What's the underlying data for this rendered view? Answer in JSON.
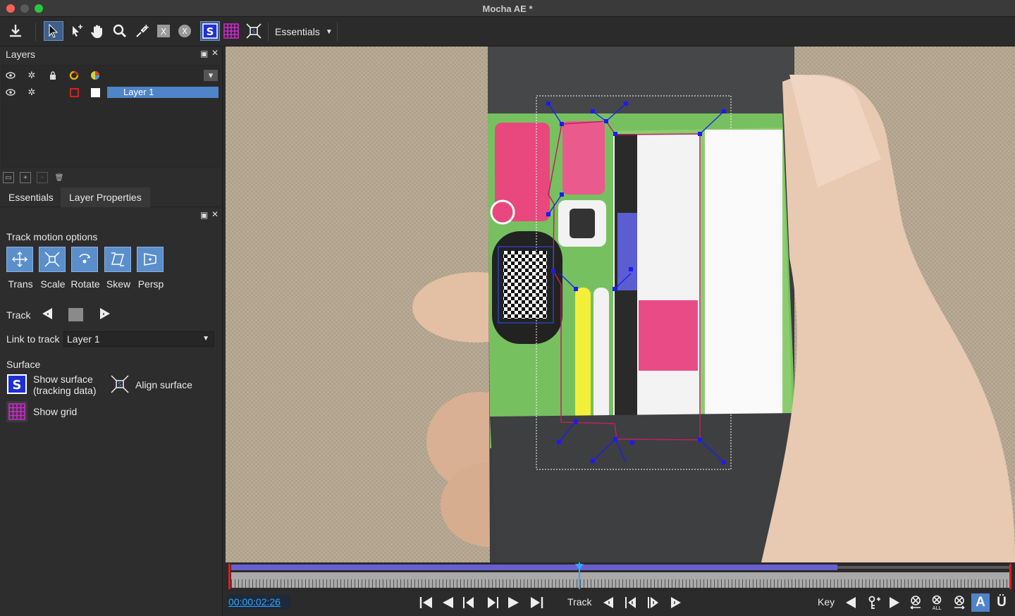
{
  "window": {
    "title": "Mocha AE *"
  },
  "toolbar": {
    "workspace_label": "Essentials",
    "buttons": [
      "export-icon",
      "pointer-icon",
      "add-point-icon",
      "hand-icon",
      "zoom-icon",
      "pen-icon",
      "x-spline-icon",
      "bezier-icon",
      "surface-icon",
      "grid-icon",
      "align-icon"
    ]
  },
  "layers_panel": {
    "title": "Layers",
    "layers": [
      {
        "name": "Layer 1",
        "color": "#d62020"
      }
    ]
  },
  "tabs": [
    {
      "label": "Essentials"
    },
    {
      "label": "Layer Properties"
    }
  ],
  "essentials": {
    "track_motion_title": "Track motion options",
    "motion_options": [
      {
        "label": "Trans",
        "icon": "translation-icon"
      },
      {
        "label": "Scale",
        "icon": "scale-icon"
      },
      {
        "label": "Rotate",
        "icon": "rotate-icon"
      },
      {
        "label": "Skew",
        "icon": "skew-icon"
      },
      {
        "label": "Persp",
        "icon": "perspective-icon"
      }
    ],
    "track_label": "Track",
    "link_to_track_label": "Link to track",
    "link_to_track_value": "Layer 1",
    "surface_title": "Surface",
    "show_surface_label_1": "Show surface",
    "show_surface_label_2": "(tracking data)",
    "align_surface_label": "Align surface",
    "show_grid_label": "Show grid"
  },
  "timeline": {
    "playhead_fraction": 0.446
  },
  "transport": {
    "timecode": "00:00:02:26",
    "track_label": "Track",
    "key_label": "Key"
  },
  "colors": {
    "accent": "#4f84c8",
    "timecode": "#2fa6ff",
    "range": "#6a5fd0",
    "spline": "#1a1aff"
  }
}
